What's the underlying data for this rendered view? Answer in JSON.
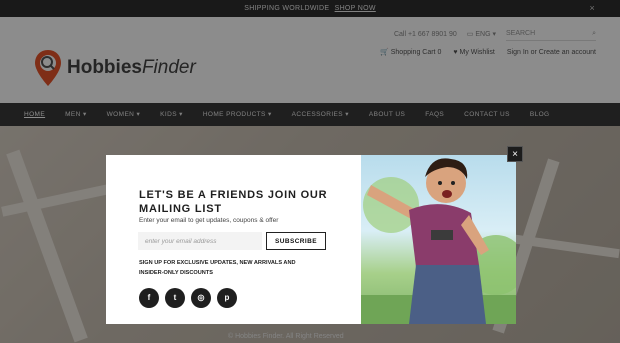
{
  "topbar": {
    "text": "SHIPPING WORLDWIDE",
    "link": "SHOP NOW",
    "close": "×"
  },
  "header": {
    "logo_main": "Hobbies",
    "logo_accent": "Finder",
    "phone": "Call +1 667 8901 90",
    "language": "ENG",
    "search_placeholder": "SEARCH",
    "cart_label": "Shopping Cart",
    "cart_count": "0",
    "wishlist_label": "My Wishlist",
    "account_label": "Sign In or Create an account"
  },
  "nav": {
    "items": [
      {
        "label": "HOME",
        "dropdown": false
      },
      {
        "label": "MEN",
        "dropdown": true
      },
      {
        "label": "WOMEN",
        "dropdown": true
      },
      {
        "label": "KIDS",
        "dropdown": true
      },
      {
        "label": "HOME PRODUCTS",
        "dropdown": true
      },
      {
        "label": "ACCESSORIES",
        "dropdown": true
      },
      {
        "label": "ABOUT US",
        "dropdown": false
      },
      {
        "label": "FAQS",
        "dropdown": false
      },
      {
        "label": "CONTACT US",
        "dropdown": false
      },
      {
        "label": "BLOG",
        "dropdown": false
      }
    ]
  },
  "hero": {
    "footer_text": "© Hobbies Finder. All Right Reserved"
  },
  "popup": {
    "close": "×",
    "title": "LET'S BE A FRIENDS JOIN OUR MAILING LIST",
    "subtitle": "Enter your email to get updates, coupons & offer",
    "email_placeholder": "enter your email address",
    "subscribe_label": "SUBSCRIBE",
    "signup_note": "SIGN UP FOR EXCLUSIVE UPDATES, NEW ARRIVALS AND INSIDER-ONLY DISCOUNTS",
    "socials": [
      {
        "icon": "facebook-icon",
        "glyph": "f"
      },
      {
        "icon": "twitter-icon",
        "glyph": "t"
      },
      {
        "icon": "instagram-icon",
        "glyph": "◎"
      },
      {
        "icon": "pinterest-icon",
        "glyph": "p"
      }
    ]
  },
  "colors": {
    "topbar_bg": "#2f2f2f",
    "nav_bg": "#3a3a3a",
    "text_dark": "#1e1e1e",
    "overlay": "rgba(0,0,0,0.45)"
  }
}
